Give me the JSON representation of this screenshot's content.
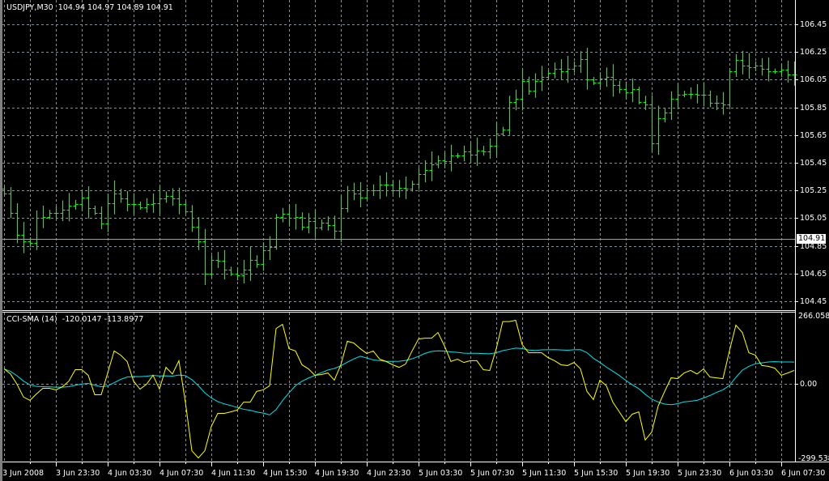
{
  "header": {
    "symbol_timeframe": "USDJPY,M30",
    "ohlc_text": "104.94 104.97 104.89 104.91"
  },
  "indicator": {
    "name": "CCI-SMA (14)",
    "values_text": "-120.0147 -113.8977",
    "axis_max_label": "266.0584",
    "axis_zero_label": "0.00",
    "axis_min_label": "-299.538"
  },
  "bid_label": "104.91",
  "price_axis": [
    "106.45",
    "106.25",
    "106.05",
    "105.85",
    "105.65",
    "105.45",
    "105.25",
    "105.05",
    "104.85",
    "104.65",
    "104.45"
  ],
  "time_axis": [
    "3 Jun 2008",
    "3 Jun 23:30",
    "4 Jun 03:30",
    "4 Jun 07:30",
    "4 Jun 11:30",
    "4 Jun 15:30",
    "4 Jun 19:30",
    "4 Jun 23:30",
    "5 Jun 03:30",
    "5 Jun 07:30",
    "5 Jun 11:30",
    "5 Jun 15:30",
    "5 Jun 19:30",
    "5 Jun 23:30",
    "6 Jun 03:30",
    "6 Jun 07:30"
  ],
  "colors": {
    "background": "#000000",
    "bars": "#00ff00",
    "grid": "#8090a0",
    "cci": "#ffff00",
    "signal": "#00e5ee",
    "bid_line": "#a0a0a0"
  },
  "chart_data": [
    {
      "type": "ohlc",
      "title": "USDJPY,M30",
      "ylim": [
        104.45,
        106.45
      ],
      "grid": true,
      "close": [
        105.23,
        105.09,
        104.93,
        104.88,
        104.87,
        105.05,
        105.06,
        105.09,
        105.09,
        105.11,
        105.14,
        105.15,
        105.2,
        105.12,
        105.09,
        105.01,
        105.16,
        105.23,
        105.19,
        105.15,
        105.15,
        105.13,
        105.15,
        105.16,
        105.19,
        105.21,
        105.19,
        105.15,
        105.1,
        104.99,
        104.88,
        104.65,
        104.75,
        104.74,
        104.68,
        104.65,
        104.64,
        104.68,
        104.75,
        104.72,
        104.82,
        104.84,
        105.06,
        105.08,
        105.05,
        105.06,
        104.99,
        105.03,
        104.98,
        105.02,
        105.0,
        104.96,
        105.12,
        105.25,
        105.23,
        105.2,
        105.25,
        105.25,
        105.29,
        105.29,
        105.25,
        105.27,
        105.26,
        105.3,
        105.37,
        105.4,
        105.44,
        105.47,
        105.46,
        105.5,
        105.5,
        105.53,
        105.51,
        105.54,
        105.53,
        105.57,
        105.66,
        105.69,
        105.89,
        105.91,
        106.04,
        105.97,
        106.04,
        106.07,
        106.1,
        106.13,
        106.11,
        106.13,
        106.15,
        106.2,
        106.05,
        106.03,
        106.06,
        106.07,
        106.01,
        105.98,
        105.96,
        105.98,
        105.89,
        105.87,
        105.59,
        105.77,
        105.81,
        105.91,
        105.94,
        105.95,
        105.95,
        105.94,
        105.94,
        105.88,
        105.88,
        105.87,
        106.11,
        106.19,
        106.15,
        106.14,
        106.15,
        106.13,
        106.11,
        106.11,
        106.12,
        106.09,
        106.09
      ]
    },
    {
      "type": "line",
      "title": "CCI-SMA (14)",
      "ylim": [
        -299.538,
        266.0584
      ],
      "series": [
        {
          "name": "CCI",
          "values": [
            60,
            40,
            0,
            -50,
            -63,
            -38,
            -16,
            -16,
            -22,
            -10,
            12,
            57,
            57,
            35,
            -41,
            -41,
            44,
            130,
            114,
            89,
            12,
            -19,
            0,
            35,
            -19,
            66,
            40,
            92,
            -70,
            -260,
            -288,
            -260,
            -165,
            -114,
            -114,
            -108,
            -101,
            -70,
            -70,
            -28,
            -22,
            -6,
            218,
            234,
            139,
            130,
            76,
            60,
            35,
            38,
            44,
            16,
            76,
            168,
            161,
            139,
            120,
            130,
            98,
            89,
            76,
            66,
            79,
            130,
            177,
            180,
            180,
            202,
            150,
            89,
            98,
            85,
            92,
            92,
            57,
            54,
            139,
            245,
            245,
            250,
            155,
            123,
            123,
            123,
            104,
            92,
            76,
            73,
            85,
            60,
            -28,
            -60,
            16,
            -6,
            -70,
            -108,
            -146,
            -117,
            -108,
            -218,
            -187,
            -85,
            -28,
            25,
            22,
            44,
            54,
            40,
            60,
            28,
            25,
            22,
            130,
            231,
            202,
            123,
            114,
            73,
            70,
            63,
            35,
            44,
            54
          ]
        },
        {
          "name": "SMA",
          "period": 14,
          "source": "CCI"
        }
      ]
    }
  ]
}
